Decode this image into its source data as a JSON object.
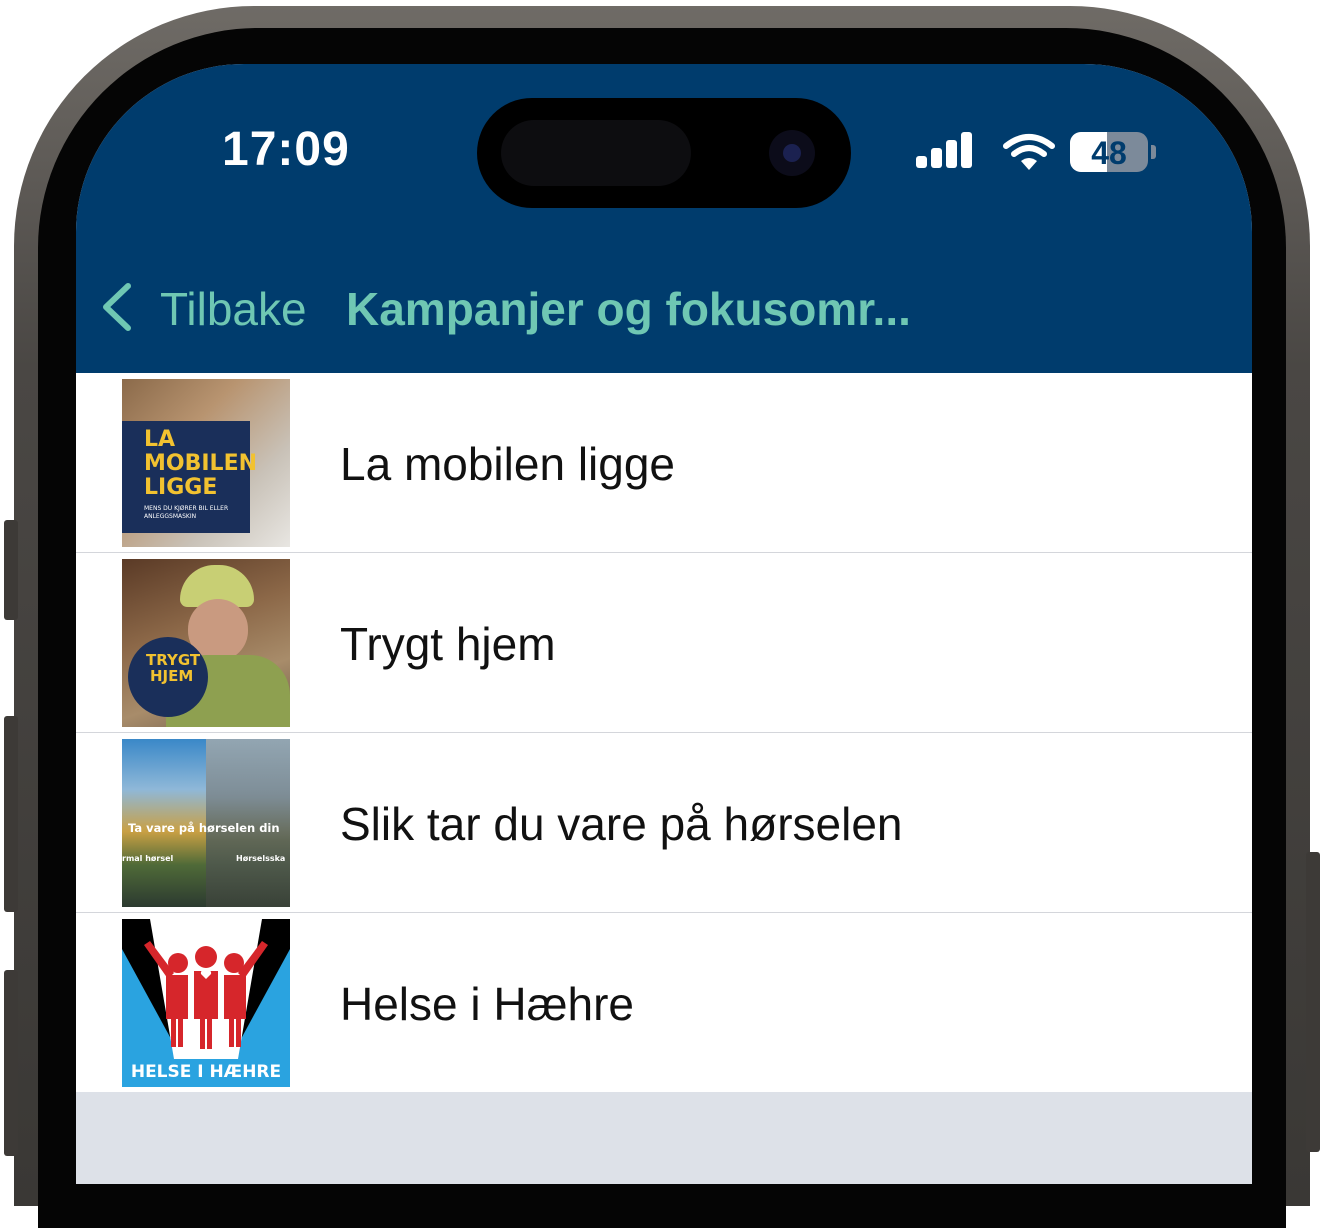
{
  "status_bar": {
    "time": "17:09",
    "battery": "48",
    "battery_level": 0.48,
    "icons": [
      "signal-icon",
      "wifi-icon",
      "battery-icon"
    ]
  },
  "nav": {
    "back_label": "Tilbake",
    "title": "Kampanjer og fokusomr..."
  },
  "colors": {
    "header": "#003c6d",
    "accent": "#6fc7b3",
    "list_bg": "#ffffff",
    "footer_bg": "#dde1e8"
  },
  "items": [
    {
      "label": "La mobilen ligge",
      "thumb_text": [
        "LA",
        "MOBILEN",
        "LIGGE"
      ],
      "thumb_subtext": "MENS DU KJØRER BIL ELLER ANLEGGSMASKIN"
    },
    {
      "label": "Trygt hjem",
      "thumb_text": [
        "TRYGT",
        "HJEM"
      ]
    },
    {
      "label": "Slik tar du vare på hørselen",
      "thumb_text": [
        "Ta vare på hørselen din"
      ],
      "thumb_subtext_left": "rmal hørsel",
      "thumb_subtext_right": "Hørselsska"
    },
    {
      "label": "Helse i Hæhre",
      "thumb_text": [
        "HELSE I HÆHRE"
      ]
    }
  ]
}
